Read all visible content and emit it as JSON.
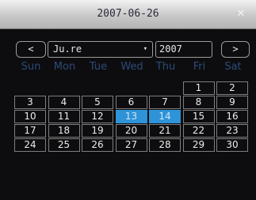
{
  "title": "2007-06-26",
  "icons": {
    "close": "close-icon",
    "prev": "prev-arrow-icon",
    "next": "next-arrow-icon",
    "dropdown": "dropdown-arrow-icon"
  },
  "controls": {
    "prev_label": "<",
    "next_label": ">",
    "month_value": "Ju.re",
    "dropdown_arrow": "▾",
    "year_value": "2007"
  },
  "weekdays": [
    "Sun",
    "Mon",
    "Tue",
    "Wed",
    "Thu",
    "Fri",
    "Sat"
  ],
  "weeks": [
    [
      "",
      "",
      "",
      "",
      "",
      "1",
      "2"
    ],
    [
      "3",
      "4",
      "5",
      "6",
      "7",
      "8",
      "9"
    ],
    [
      "10",
      "11",
      "12",
      "13",
      "14",
      "15",
      "16"
    ],
    [
      "17",
      "18",
      "19",
      "20",
      "21",
      "22",
      "23"
    ],
    [
      "24",
      "25",
      "26",
      "27",
      "28",
      "29",
      "30"
    ]
  ],
  "selected_days": [
    "13",
    "14"
  ],
  "colors": {
    "background": "#0d0d0f",
    "selected": "#2f93d8",
    "weekday_text": "#2e4a78",
    "cell_text": "#ececec"
  }
}
